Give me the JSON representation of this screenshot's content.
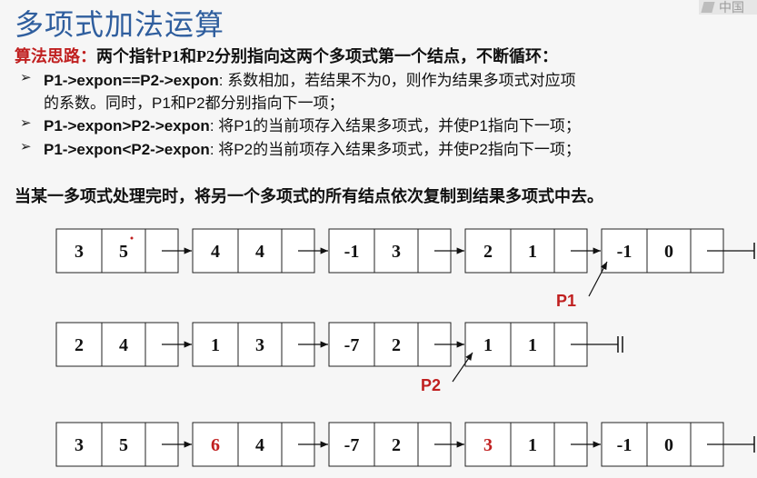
{
  "title": "多项式加法运算",
  "logo": "中国",
  "idea": {
    "label": "算法思路：",
    "text": "两个指针P1和P2分别指向这两个多项式第一个结点，不断循环："
  },
  "bullets": [
    {
      "cond": "P1->expon==P2->expon",
      "text": ": 系数相加，若结果不为0，则作为结果多项式对应项",
      "cont": "的系数。同时，P1和P2都分别指向下一项；"
    },
    {
      "cond": "P1->expon>P2->expon",
      "text": ": 将P1的当前项存入结果多项式，并使P1指向下一项；"
    },
    {
      "cond": "P1->expon<P2->expon",
      "text": ": 将P2的当前项存入结果多项式，并使P2指向下一项；"
    }
  ],
  "summary": "当某一多项式处理完时，将另一个多项式的所有结点依次复制到结果多项式中去。",
  "lists": [
    {
      "nodes": [
        [
          "3",
          "5"
        ],
        [
          "4",
          "4"
        ],
        [
          "-1",
          "3"
        ],
        [
          "2",
          "1"
        ],
        [
          "-1",
          "0"
        ]
      ]
    },
    {
      "nodes": [
        [
          "2",
          "4"
        ],
        [
          "1",
          "3"
        ],
        [
          "-7",
          "2"
        ],
        [
          "1",
          "1"
        ]
      ]
    },
    {
      "nodes": [
        [
          "3",
          "5"
        ],
        [
          "6",
          "4"
        ],
        [
          "-7",
          "2"
        ],
        [
          "3",
          "1"
        ],
        [
          "-1",
          "0"
        ]
      ],
      "highlight": [
        1,
        3
      ]
    }
  ],
  "pointers": {
    "p1": "P1",
    "p2": "P2"
  },
  "colors": {
    "title": "#2f5e9e",
    "accent": "#c02020"
  }
}
